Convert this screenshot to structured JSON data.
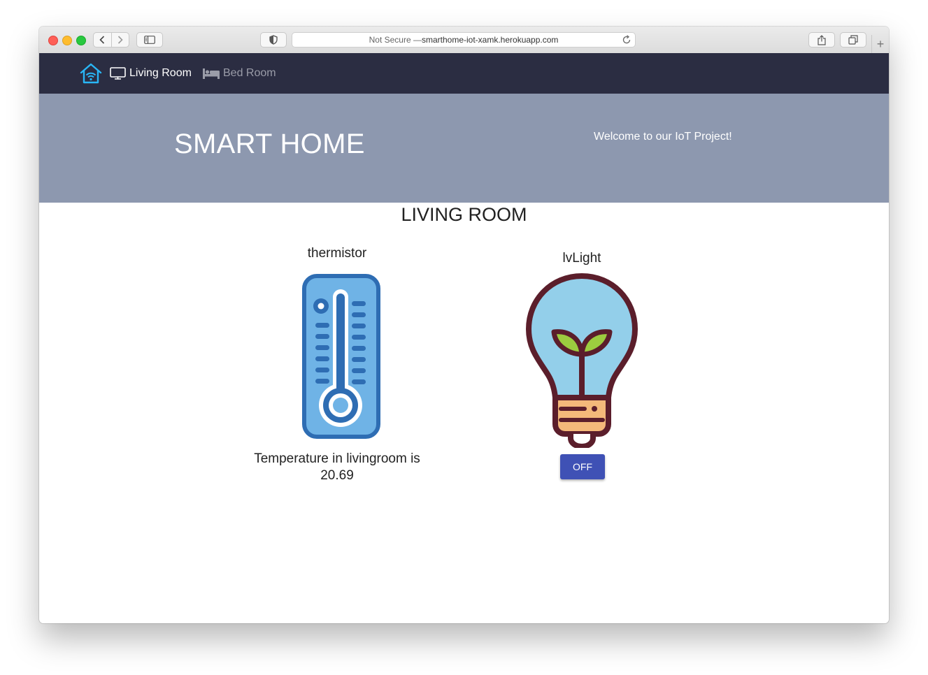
{
  "browser": {
    "url_prefix": "Not Secure — ",
    "url_host": "smarthome-iot-xamk.herokuapp.com",
    "new_tab_label": "+"
  },
  "nav": {
    "items": [
      {
        "label": "Living Room",
        "icon": "monitor-icon",
        "active": true
      },
      {
        "label": "Bed Room",
        "icon": "bed-icon",
        "active": false
      }
    ]
  },
  "hero": {
    "title": "SMART HOME",
    "subtitle": "Welcome to our IoT Project!"
  },
  "room": {
    "title": "LIVING ROOM",
    "devices": [
      {
        "name": "thermistor",
        "icon": "thermometer-icon",
        "reading_line1": "Temperature in livingroom is",
        "reading_line2": "20.69"
      },
      {
        "name": "lvLight",
        "icon": "lightbulb-icon",
        "button_label": "OFF"
      }
    ]
  },
  "colors": {
    "navbar": "#2b2d42",
    "hero": "#8d98af",
    "button": "#3f51b5",
    "logo": "#29b6f6"
  }
}
